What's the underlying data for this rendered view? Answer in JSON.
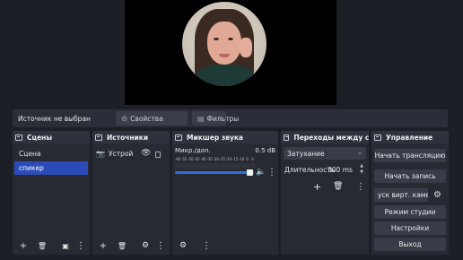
{
  "context_bar": {
    "no_source": "Источник не выбран",
    "properties": "Свойства",
    "filters": "Фильтры"
  },
  "scenes": {
    "title": "Сцены",
    "items": [
      "Сцена",
      "спикер"
    ],
    "selected_index": 1
  },
  "sources": {
    "title": "Источники",
    "items": [
      {
        "name": "Устрой",
        "icon": "camera-icon",
        "visible": true,
        "locked": false
      }
    ]
  },
  "mixer": {
    "title": "Микшер звука",
    "channel": {
      "name": "Микр./доп.",
      "level": "0.5 dB",
      "scale": [
        "-60",
        "-55",
        "-50",
        "-45",
        "-40",
        "-35",
        "-30",
        "-25",
        "-20",
        "-15",
        "-10",
        "-5",
        "0"
      ],
      "muted": true
    }
  },
  "transitions": {
    "title": "Переходы между сцена...",
    "selected": "Затухание",
    "duration_label": "Длительность",
    "duration_value": "300 ms"
  },
  "controls": {
    "title": "Управление",
    "start_stream": "Начать трансляцию",
    "start_record": "Начать запись",
    "virtual_cam": "уск вирт. каме",
    "studio_mode": "Режим студии",
    "settings": "Настройки",
    "exit": "Выход"
  }
}
